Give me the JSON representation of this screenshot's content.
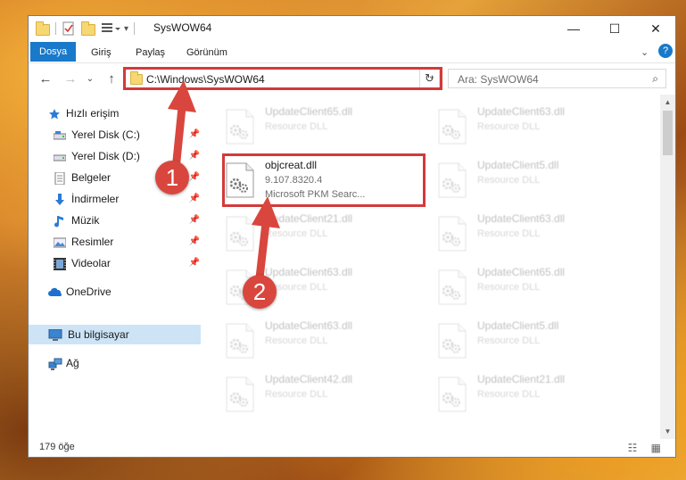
{
  "window": {
    "title": "SysWOW64",
    "minimize": "—",
    "maximize": "☐",
    "close": "✕",
    "help": "?"
  },
  "ribbon": {
    "tabs": [
      {
        "label": "Dosya",
        "active": true
      },
      {
        "label": "Giriş"
      },
      {
        "label": "Paylaş"
      },
      {
        "label": "Görünüm"
      }
    ],
    "expand": "⌄"
  },
  "nav": {
    "back": "←",
    "forward": "→",
    "recent": "⌄",
    "up": "↑",
    "address": "C:\\Windows\\SysWOW64",
    "refresh": "↻",
    "search_placeholder": "Ara: SysWOW64",
    "search_icon": "⌕"
  },
  "sidebar": {
    "items": [
      {
        "label": "Hızlı erişim",
        "icon": "star-icon",
        "pinned": false
      },
      {
        "label": "Yerel Disk (C:)",
        "icon": "drive-icon",
        "pinned": true
      },
      {
        "label": "Yerel Disk (D:)",
        "icon": "drive-icon",
        "pinned": true
      },
      {
        "label": "Belgeler",
        "icon": "document-icon",
        "pinned": true
      },
      {
        "label": "İndirmeler",
        "icon": "download-icon",
        "pinned": true
      },
      {
        "label": "Müzik",
        "icon": "music-icon",
        "pinned": true
      },
      {
        "label": "Resimler",
        "icon": "picture-icon",
        "pinned": true
      },
      {
        "label": "Videolar",
        "icon": "video-icon",
        "pinned": true
      },
      {
        "label": "OneDrive",
        "icon": "cloud-icon",
        "pinned": false
      },
      {
        "label": "Bu bilgisayar",
        "icon": "computer-icon",
        "pinned": false,
        "selected": true
      },
      {
        "label": "Ağ",
        "icon": "network-icon",
        "pinned": false
      }
    ],
    "pin_glyph": "📌"
  },
  "files": {
    "left": [
      {
        "name": "UpdateClient65.dll",
        "line2": "Resource DLL",
        "line3": ""
      },
      {
        "name": "objcreat.dll",
        "line2": "9.107.8320.4",
        "line3": "Microsoft PKM Searc...",
        "highlight": true
      },
      {
        "name": "UpdateClient21.dll",
        "line2": "Resource DLL",
        "line3": ""
      },
      {
        "name": "UpdateClient63.dll",
        "line2": "Resource DLL",
        "line3": ""
      },
      {
        "name": "UpdateClient63.dll",
        "line2": "Resource DLL",
        "line3": ""
      },
      {
        "name": "UpdateClient42.dll",
        "line2": "Resource DLL",
        "line3": ""
      }
    ],
    "right": [
      {
        "name": "UpdateClient63.dll",
        "line2": "Resource DLL",
        "line3": ""
      },
      {
        "name": "UpdateClient5.dll",
        "line2": "Resource DLL",
        "line3": ""
      },
      {
        "name": "UpdateClient63.dll",
        "line2": "Resource DLL",
        "line3": ""
      },
      {
        "name": "UpdateClient65.dll",
        "line2": "Resource DLL",
        "line3": ""
      },
      {
        "name": "UpdateClient5.dll",
        "line2": "Resource DLL",
        "line3": ""
      },
      {
        "name": "UpdateClient21.dll",
        "line2": "Resource DLL",
        "line3": ""
      }
    ]
  },
  "status": {
    "count": "179 öğe",
    "views": "☷ ▦"
  },
  "annotations": [
    {
      "number": "1"
    },
    {
      "number": "2"
    }
  ],
  "colors": {
    "accent": "#1979ca",
    "highlight_box": "#d33a3a",
    "badge": "#d9463e",
    "selected": "#cde4f7"
  }
}
